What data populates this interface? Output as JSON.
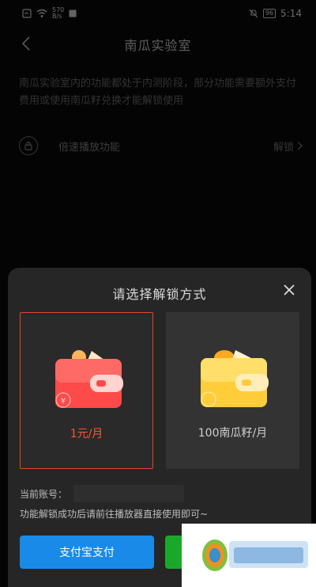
{
  "status_bar": {
    "speed_value": "570",
    "speed_unit": "B/s",
    "battery": "96",
    "time": "5:14"
  },
  "nav": {
    "title": "南瓜实验室"
  },
  "notice": "南瓜实验室内的功能都处于内测阶段，部分功能需要额外支付费用或使用南瓜籽兑换才能解锁使用",
  "feature": {
    "label": "倍速播放功能",
    "action": "解锁"
  },
  "sheet": {
    "title": "请选择解锁方式",
    "options": [
      {
        "label": "1元/月",
        "selected": true
      },
      {
        "label": "100南瓜籽/月",
        "selected": false
      }
    ],
    "account_label": "当前账号：",
    "hint": "功能解锁成功后请前往播放器直接使用即可~",
    "alipay_button": "支付宝支付"
  },
  "colors": {
    "accent_red": "#e0462e",
    "alipay_blue": "#1a8ae8",
    "wechat_green": "#1aa82b"
  }
}
